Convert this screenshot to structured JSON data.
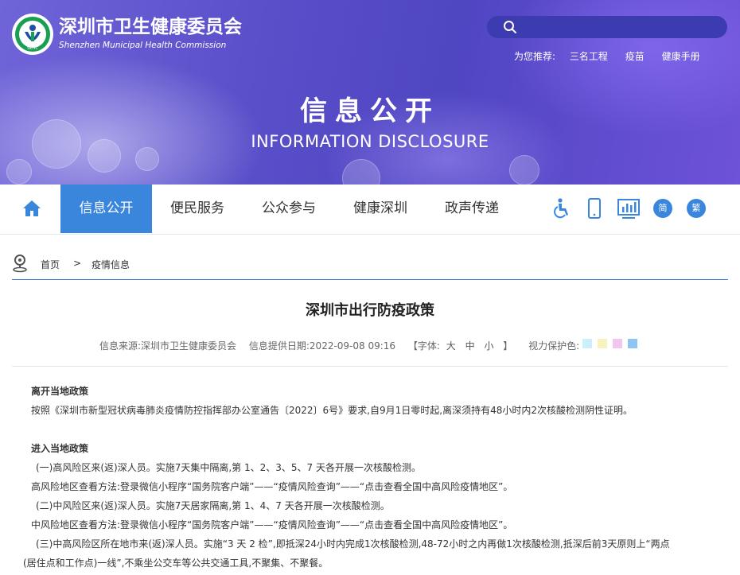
{
  "header": {
    "logo_cn": "深圳市卫生健康委员会",
    "logo_en": "Shenzhen Municipal Health Commission",
    "logo_badge": "SZHC",
    "search_placeholder": "",
    "recommend_label": "为您推荐:",
    "recommend_links": [
      "三名工程",
      "疫苗",
      "健康手册"
    ],
    "banner_title": "信息公开",
    "banner_subtitle": "INFORMATION DISCLOSURE"
  },
  "nav": {
    "items": [
      "信息公开",
      "便民服务",
      "公众参与",
      "健康深圳",
      "政声传递"
    ],
    "active_index": 0,
    "simplified_label": "简",
    "traditional_label": "繁",
    "tools": [
      "accessibility-icon",
      "mobile-icon",
      "chart-icon"
    ]
  },
  "breadcrumb": {
    "home": "首页",
    "separator": ">",
    "current": "疫情信息"
  },
  "article": {
    "title": "深圳市出行防疫政策",
    "source": "信息来源:深圳市卫生健康委员会",
    "date": "信息提供日期:2022-09-08 09:16",
    "font_open": "【字体:",
    "font_sizes": [
      "大",
      "中",
      "小"
    ],
    "font_close": "】",
    "eye_care": "视力保护色:",
    "eye_colors": [
      "#cdeffb",
      "#f6f3bf",
      "#f1c6ee",
      "#8ec4ef"
    ],
    "lines": [
      "离开当地政策",
      "按照《深圳市新型冠状病毒肺炎疫情防控指挥部办公室通告〔2022〕6号》要求,自9月1日零时起,离深须持有48小时内2次核酸检测阴性证明。",
      "进入当地政策",
      "(一)高风险区来(返)深人员。实施7天集中隔离,第 1、2、3、5、7 天各开展一次核酸检测。",
      "高风险地区查看方法:登录微信小程序“国务院客户端”——“疫情风险查询”——“点击查看全国中高风险疫情地区”。",
      "(二)中风险区来(返)深人员。实施7天居家隔离,第 1、4、7 天各开展一次核酸检测。",
      "中风险地区查看方法:登录微信小程序“国务院客户端”——“疫情风险查询”——“点击查看全国中高风险疫情地区”。",
      "(三)中高风险区所在地市来(返)深人员。实施“3 天 2 检”,即抵深24小时内完成1次核酸检测,48-72小时之内再做1次核酸检测,抵深后前3天原则上“两点",
      "(居住点和工作点)一线”,不乘坐公交车等公共交通工具,不聚集、不聚餐。"
    ]
  }
}
